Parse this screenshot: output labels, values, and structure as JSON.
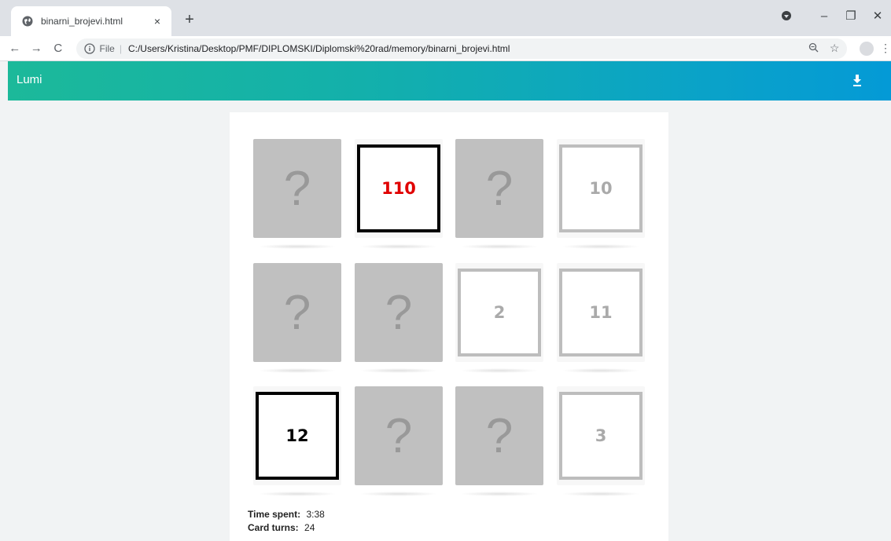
{
  "browser": {
    "tab_title": "binarni_brojevi.html",
    "tab_close": "×",
    "new_tab": "+",
    "url_scheme": "File",
    "url_sep": "|",
    "url": "C:/Users/Kristina/Desktop/PMF/DIPLOMSKI/Diplomski%20rad/memory/binarni_brojevi.html"
  },
  "header": {
    "title": "Lumi"
  },
  "cards": [
    {
      "state": "hidden",
      "symbol": "?"
    },
    {
      "state": "revealed",
      "symbol": "110",
      "color": "#e00000",
      "frame": "dark"
    },
    {
      "state": "hidden",
      "symbol": "?"
    },
    {
      "state": "matched",
      "symbol": "10",
      "color": "#aaaaaa",
      "frame": "grey"
    },
    {
      "state": "hidden",
      "symbol": "?"
    },
    {
      "state": "hidden",
      "symbol": "?"
    },
    {
      "state": "matched",
      "symbol": "2",
      "color": "#aaaaaa",
      "frame": "grey"
    },
    {
      "state": "matched",
      "symbol": "11",
      "color": "#aaaaaa",
      "frame": "grey"
    },
    {
      "state": "revealed",
      "symbol": "12",
      "color": "#000000",
      "frame": "dark"
    },
    {
      "state": "hidden",
      "symbol": "?"
    },
    {
      "state": "hidden",
      "symbol": "?"
    },
    {
      "state": "matched",
      "symbol": "3",
      "color": "#aaaaaa",
      "frame": "grey"
    }
  ],
  "stats": {
    "time_label": "Time spent:",
    "time_value": "3:38",
    "turns_label": "Card turns:",
    "turns_value": "24"
  },
  "colors": {
    "gradient_start": "#1cb99a",
    "gradient_end": "#049ad6",
    "card_back": "#c0c0c0"
  }
}
